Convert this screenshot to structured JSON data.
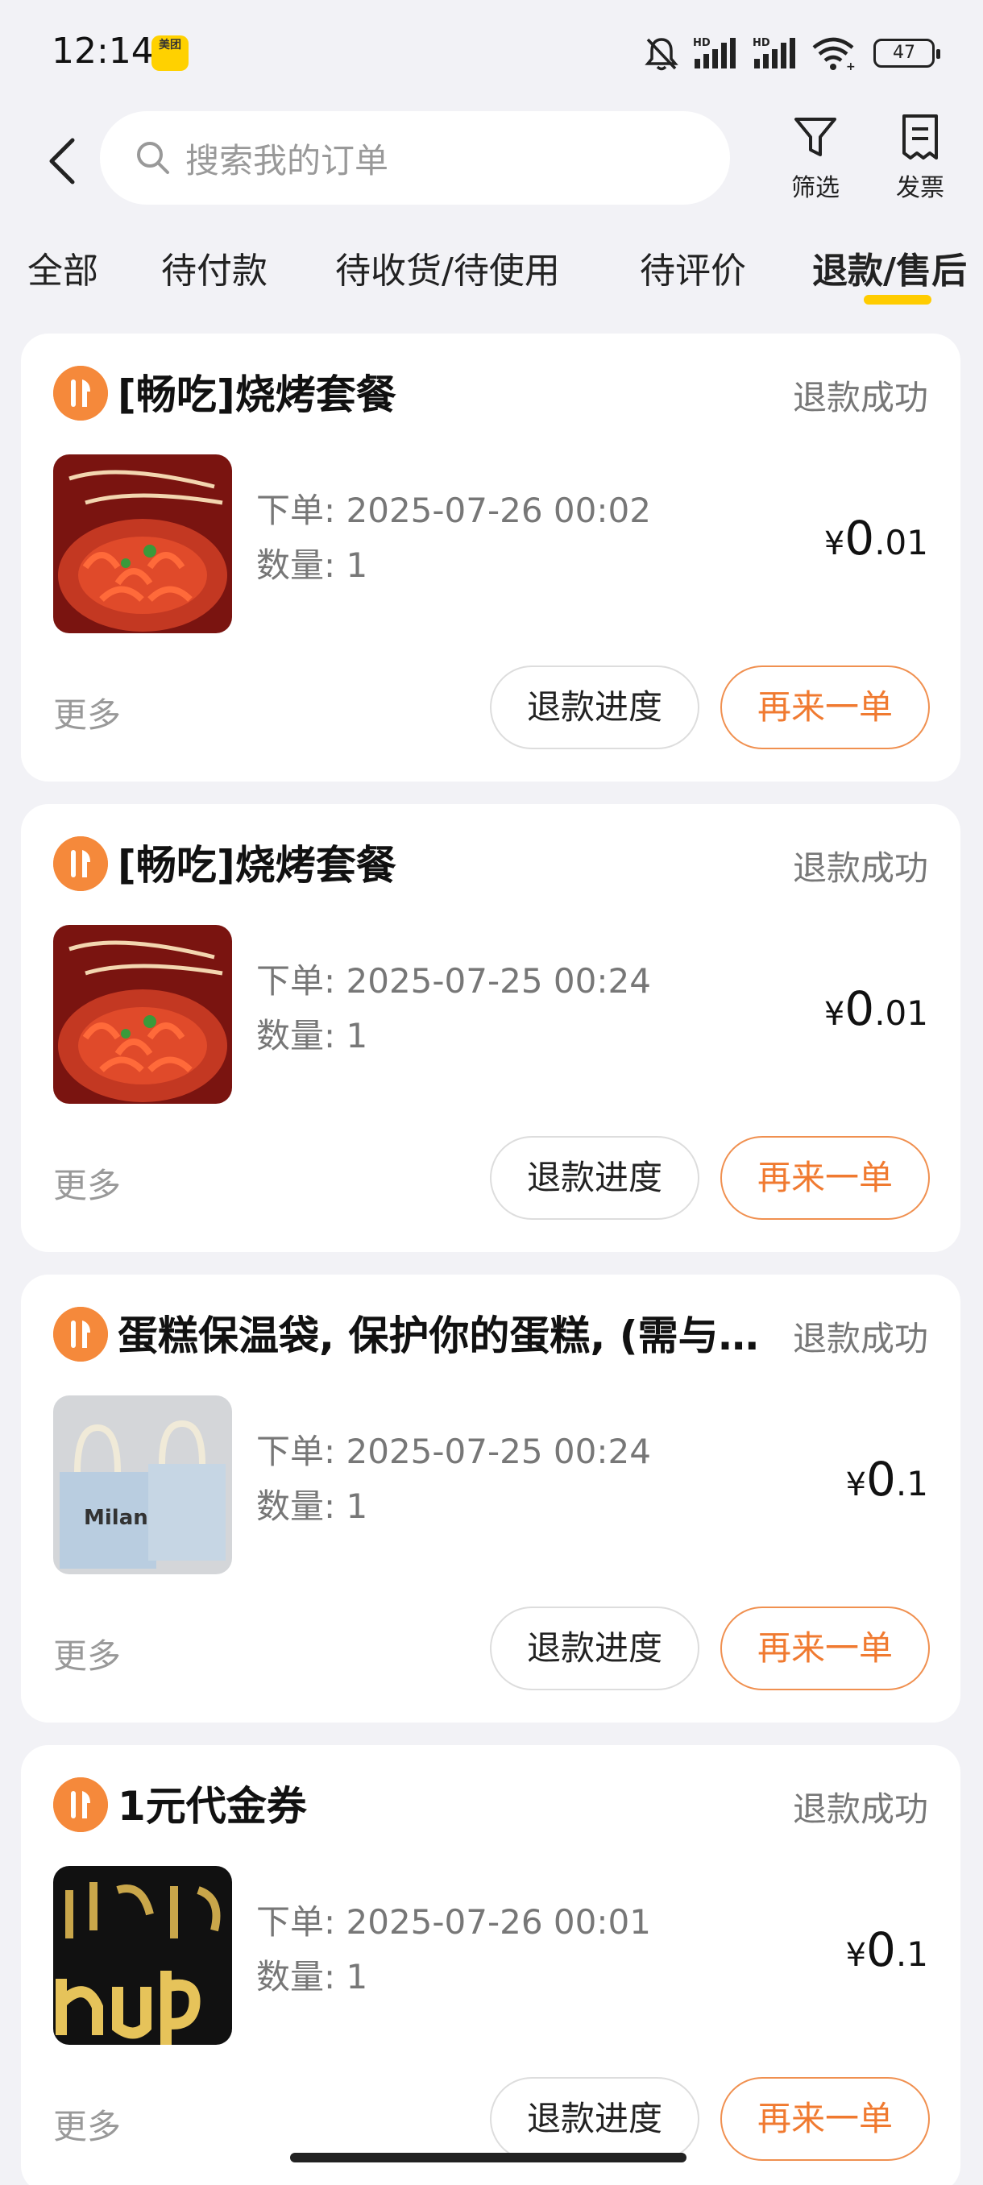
{
  "status_bar": {
    "time": "12:14",
    "app_icon_label": "美团",
    "battery": "47",
    "icons": [
      "mute-icon",
      "signal-hd-icon",
      "signal-hd-icon",
      "wifi-icon",
      "battery-icon"
    ]
  },
  "search": {
    "placeholder": "搜索我的订单"
  },
  "header": {
    "filter_label": "筛选",
    "invoice_label": "发票"
  },
  "tabs": [
    {
      "label": "全部"
    },
    {
      "label": "待付款"
    },
    {
      "label": "待收货/待使用"
    },
    {
      "label": "待评价"
    },
    {
      "label": "退款/售后",
      "active": true
    }
  ],
  "colors": {
    "accent": "#ffcc00",
    "orange": "#f07a30",
    "shop_icon": "#f5893b"
  },
  "orders": [
    {
      "title": "[畅吃]烧烤套餐",
      "status": "退款成功",
      "thumb": "crayfish",
      "time": "下单: 2025-07-26 00:02",
      "qty": "数量: 1",
      "price_yen": "¥",
      "price_int": "0",
      "price_dec": ".01",
      "more": "更多",
      "btn_refund": "退款进度",
      "btn_reorder": "再来一单"
    },
    {
      "title": "[畅吃]烧烤套餐",
      "status": "退款成功",
      "thumb": "crayfish",
      "time": "下单: 2025-07-25 00:24",
      "qty": "数量: 1",
      "price_yen": "¥",
      "price_int": "0",
      "price_dec": ".01",
      "more": "更多",
      "btn_refund": "退款进度",
      "btn_reorder": "再来一单"
    },
    {
      "title": "蛋糕保温袋, 保护你的蛋糕, (需与…",
      "status": "退款成功",
      "thumb": "bags",
      "thumb_text": "Milan",
      "time": "下单: 2025-07-25 00:24",
      "qty": "数量: 1",
      "price_yen": "¥",
      "price_int": "0",
      "price_dec": ".1",
      "more": "更多",
      "btn_refund": "退款进度",
      "btn_reorder": "再来一单"
    },
    {
      "title": "1元代金券",
      "status": "退款成功",
      "thumb": "voucher",
      "time": "下单: 2025-07-26 00:01",
      "qty": "数量: 1",
      "price_yen": "¥",
      "price_int": "0",
      "price_dec": ".1",
      "more": "更多",
      "btn_refund": "退款进度",
      "btn_reorder": "再来一单"
    }
  ]
}
